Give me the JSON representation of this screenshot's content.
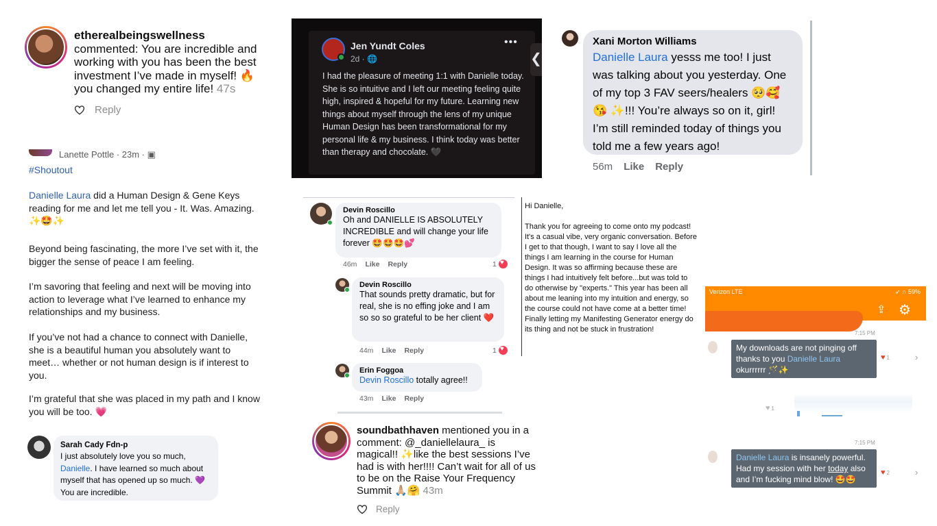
{
  "instagram_comment_1": {
    "username": "etherealbeingswellness",
    "text": "commented: You are incredible and working with you has been the best investment I’ve made in myself! 🔥 you changed my entire life!",
    "time": "47s",
    "reply_label": "Reply"
  },
  "facebook_dark_post": {
    "author": "Jen Yundt Coles",
    "meta": "2d · 🌐",
    "more": "•••",
    "body": "I had the pleasure of meeting 1:1 with Danielle today. She is so intuitive and I left our meeting feeling quite high, inspired & hopeful for my future. Learning new things about myself through the lens of my unique Human Design has been transformational for my personal life & my business. I think today was better than therapy and chocolate. 🖤"
  },
  "xani_comment": {
    "author": "Xani Morton Williams",
    "mention": "Danielle Laura",
    "text": " yesss me too! I just was talking about you yesterday. One of my top 3 FAV seers/healers 🥺🥰😘 ✨!!! You’re always so on it, girl! I’m still reminded today of things you told me a few years ago!",
    "time": "56m",
    "like_label": "Like",
    "reply_label": "Reply"
  },
  "lanette_post": {
    "author_meta": "Lanette Pottle · 23m · ▣",
    "hashtag": "#Shoutout",
    "p1_mention": "Danielle Laura",
    "p1_text": " did a Human Design & Gene Keys reading for me and let me tell you - It. Was. Amazing. ✨🤩✨",
    "p2": "Beyond being fascinating, the more I’ve set with it, the bigger the sense of peace I am feeling.",
    "p3": "I’m savoring that feeling and next will be moving into action to leverage what I’ve learned to enhance my relationships and my business.",
    "p4": "If you’ve not had a chance to connect with Danielle, she is a beautiful human you absolutely want to meet… whether or not human design is if interest to you.",
    "p5": "I’m grateful that she was placed in my path and I know you will be too. 💗"
  },
  "sarah_comment": {
    "author": "Sarah Cady Fdn-p",
    "text_a": "I just absolutely love you so much, ",
    "mention": "Danielle",
    "text_b": ". I have learned so much about myself that has opened up so much. 💜 You are incredible."
  },
  "devin_thread": {
    "c1_author": "Devin Roscillo",
    "c1_text": "Oh and DANIELLE IS ABSOLUTELY INCREDIBLE and will change your life forever 🤩🤩🤩💕",
    "c1_time": "46m",
    "c1_like": "Like",
    "c1_reply": "Reply",
    "c1_reacts": "1",
    "c2_author": "Devin Roscillo",
    "c2_text": "That sounds pretty dramatic, but for real, she is no effing joke and I am so so so grateful to be her client ❤️",
    "c2_time": "44m",
    "c2_like": "Like",
    "c2_reply": "Reply",
    "c2_reacts": "1",
    "c3_author": "Erin Foggoa",
    "c3_mention": "Devin Roscillo",
    "c3_text": " totally agree!!",
    "c3_time": "43m",
    "c3_like": "Like",
    "c3_reply": "Reply"
  },
  "email": {
    "greeting": "Hi Danielle,",
    "body": "Thank you for agreeing to come onto my podcast! It's a casual vibe, very organic conversation. Before I get to that though, I want to say I love all the things I am learning in the course for Human Design. It was so affirming because these are things I had intuitively felt before...but was told to do otherwise by \"experts.\" This year has been all about me leaning into my intuition and energy, so the course could not have come at a better time! Finally letting my Manifesting Generator energy do its thing and not be stuck in frustration!"
  },
  "soundbathhaven_comment": {
    "username": "soundbathhaven",
    "text": " mentioned you in a comment: @_daniellelaura_ is magical!! ✨like the best sessions I’ve had is with her!!!! Can’t wait for all of us to be on the Raise Your Frequency Summit 🙏🏼🤗",
    "time": "43m",
    "reply_label": "Reply"
  },
  "phone_messages": {
    "carrier": "Verizon  LTE",
    "battery": "59%",
    "time_1": "7:15 PM",
    "msg1_text_a": "My downloads are not pinging off thanks to you ",
    "msg1_mention": "Danielle Laura",
    "msg1_text_b": " okurrrrrr 🪄✨",
    "msg1_likes": "1",
    "hidden_likes": "1",
    "time_2": "7:15 PM",
    "msg2_mention": "Danielle Laura",
    "msg2_text_a": " is insanely powerful. Had my session with her ",
    "msg2_today": "today",
    "msg2_text_b": " also and I’m fucking mind blow! 🤩🤩",
    "msg2_likes": "2"
  },
  "colors": {
    "facebook_link": "#216fdb",
    "instagram_gray": "#8e8e8e",
    "love_red": "#f33e58",
    "phone_orange": "#ff8a00",
    "message_bubble": "#5c6670"
  }
}
